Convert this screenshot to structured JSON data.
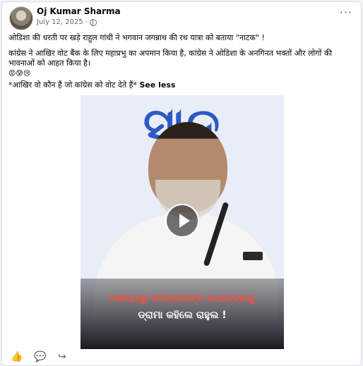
{
  "post": {
    "author": "Oj Kumar Sharma",
    "date": "July 12, 2025",
    "separator": "·",
    "more_icon": "more-icon",
    "line1": "ओडिशा की धरती पर खड़े राहुल गांधी ने भगवान जगन्नाथ की रथ यात्रा को बताया \"नाटक\" !",
    "line2": "कांग्रेस ने आखिर वोट बैंक के लिए महाप्रभु का अपमान किया है, कांग्रेस ने ओडिशा के अनगिनत भक्तों और लोगों की भावनाओं को आहत किया है।",
    "emojis": "😡😰😢",
    "line3": "*आखिर वो कौन हैं जो कांग्रेस को वोट देते हैं*",
    "see_less": "See less"
  },
  "video": {
    "background_text": "ସାଦ",
    "caption_line1": "ମହାପ୍ରଭୁ ଜଗନ୍ନାଥଙ୍କ ରଥଯାତ୍ରାକୁ",
    "caption_line2": "ଡ୍ରାମା କହିଲେ ରାହୁଲ !",
    "play_icon": "play-icon"
  },
  "actions": {
    "like": "👍",
    "comment": "💬",
    "share": "↪"
  }
}
